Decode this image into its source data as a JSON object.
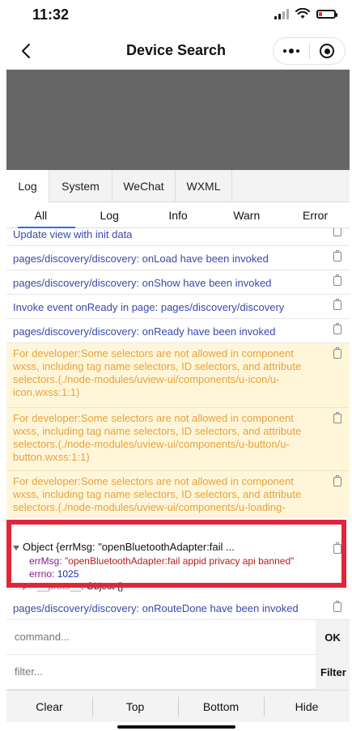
{
  "status_bar": {
    "time": "11:32"
  },
  "nav": {
    "title": "Device Search"
  },
  "console_tabs": [
    "Log",
    "System",
    "WeChat",
    "WXML"
  ],
  "filter_tabs": [
    "All",
    "Log",
    "Info",
    "Warn",
    "Error"
  ],
  "logs": [
    {
      "type": "info",
      "text": "Update view with init data"
    },
    {
      "type": "info",
      "text": "pages/discovery/discovery: onLoad have been invoked"
    },
    {
      "type": "info",
      "text": "pages/discovery/discovery: onShow have been invoked"
    },
    {
      "type": "info",
      "text": "Invoke event onReady in page: pages/discovery/discovery"
    },
    {
      "type": "info",
      "text": "pages/discovery/discovery: onReady have been invoked"
    },
    {
      "type": "warn",
      "text": "For developer:Some selectors are not allowed in component wxss, including tag name selectors, ID selectors, and attribute selectors.(./node-modules/uview-ui/components/u-icon/u-icon.wxss:1:1)"
    },
    {
      "type": "warn",
      "text": "For developer:Some selectors are not allowed in component wxss, including tag name selectors, ID selectors, and attribute selectors.(./node-modules/uview-ui/components/u-button/u-button.wxss:1:1)"
    },
    {
      "type": "warn",
      "text": "For developer:Some selectors are not allowed in component wxss, including tag name selectors, ID selectors, and attribute selectors.(./node-modules/uview-ui/components/u-loading-"
    }
  ],
  "object_log": {
    "summary": "Object {errMsg: \"openBluetoothAdapter:fail ...",
    "errMsg_key": "errMsg",
    "errMsg_value": "\"openBluetoothAdapter:fail appid privacy api banned\"",
    "errno_key": "errno",
    "errno_value": "1025",
    "proto_key": "__proto__",
    "proto_value": ": Object {}"
  },
  "last_log": "pages/discovery/discovery: onRouteDone have been invoked",
  "command": {
    "placeholder": "command...",
    "ok_label": "OK"
  },
  "filter": {
    "placeholder": "filter...",
    "button_label": "Filter"
  },
  "bottom_actions": [
    "Clear",
    "Top",
    "Bottom",
    "Hide"
  ],
  "colors": {
    "info_text": "#3949ab",
    "warn_bg": "#fff6da",
    "warn_text": "#e6a23c",
    "highlight": "#e0263b",
    "preview_area": "#666666"
  }
}
